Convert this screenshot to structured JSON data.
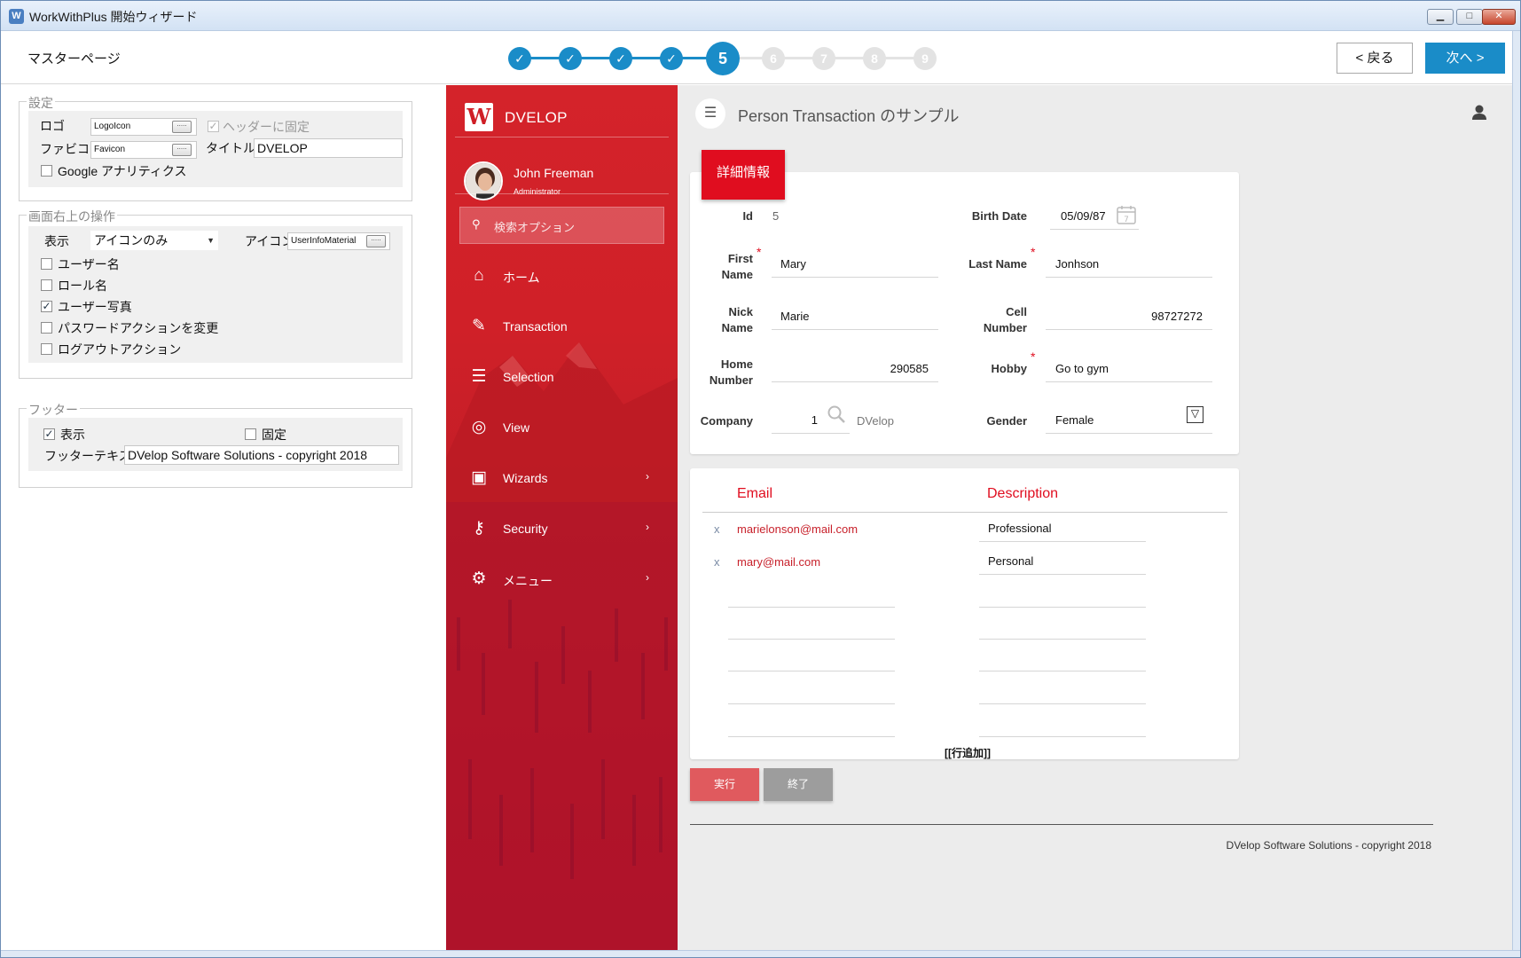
{
  "window": {
    "title": "WorkWithPlus 開始ウィザード",
    "minimize": "▁",
    "maximize": "□",
    "close": "✕"
  },
  "wizard": {
    "page_title": "マスターページ",
    "steps": [
      {
        "label": "✓",
        "state": "done"
      },
      {
        "label": "✓",
        "state": "done"
      },
      {
        "label": "✓",
        "state": "done"
      },
      {
        "label": "✓",
        "state": "done"
      },
      {
        "label": "5",
        "state": "current"
      },
      {
        "label": "6",
        "state": "future"
      },
      {
        "label": "7",
        "state": "future"
      },
      {
        "label": "8",
        "state": "future"
      },
      {
        "label": "9",
        "state": "future"
      }
    ],
    "back_label": "< 戻る",
    "next_label": "次へ >"
  },
  "settings": {
    "legend": "設定",
    "logo_label": "ロゴ",
    "logo_value": "LogoIcon",
    "favicon_label": "ファビコン",
    "favicon_value": "Favicon",
    "fixed_header_label": "ヘッダーに固定",
    "title_label": "タイトル",
    "title_value": "DVELOP",
    "google_analytics_label": "Google アナリティクス",
    "browse": "....."
  },
  "top_right_actions": {
    "legend": "画面右上の操作",
    "display_label": "表示",
    "display_value": "アイコンのみ",
    "icon_label": "アイコン",
    "icon_value": "UserInfoMaterial",
    "username_label": "ユーザー名",
    "rolename_label": "ロール名",
    "userphoto_label": "ユーザー写真",
    "change_password_label": "パスワードアクションを変更",
    "logout_label": "ログアウトアクション"
  },
  "footer_settings": {
    "legend": "フッター",
    "show_label": "表示",
    "fixed_label": "固定",
    "text_label": "フッターテキスト",
    "text_value": "DVelop Software Solutions - copyright 2018"
  },
  "preview": {
    "brand": "DVELOP",
    "brand_logo": "W",
    "user_name": "John Freeman",
    "user_role": "Administrator",
    "search_placeholder": "検索オプション",
    "menu": [
      {
        "label": "ホーム",
        "icon": "home-icon",
        "chevron": ""
      },
      {
        "label": "Transaction",
        "icon": "edit-icon",
        "chevron": ""
      },
      {
        "label": "Selection",
        "icon": "list-icon",
        "chevron": ""
      },
      {
        "label": "View",
        "icon": "target-icon",
        "chevron": ""
      },
      {
        "label": "Wizards",
        "icon": "briefcase-icon",
        "chevron": "›"
      },
      {
        "label": "Security",
        "icon": "key-icon",
        "chevron": "›"
      },
      {
        "label": "メニュー",
        "icon": "gears-icon",
        "chevron": "›"
      }
    ],
    "page_title": "Person Transaction のサンプル",
    "detail_tab": "詳細情報",
    "fields": {
      "id_label": "Id",
      "id_value": "5",
      "birth_label": "Birth Date",
      "birth_value": "05/09/87",
      "first_label": "First\nName",
      "first_value": "Mary",
      "last_label": "Last Name",
      "last_value": "Jonhson",
      "nick_label": "Nick\nName",
      "nick_value": "Marie",
      "cell_label": "Cell\nNumber",
      "cell_value": "98727272",
      "home_label": "Home\nNumber",
      "home_value": "290585",
      "hobby_label": "Hobby",
      "hobby_value": "Go to gym",
      "company_label": "Company",
      "company_value": "1",
      "company_name": "DVelop",
      "gender_label": "Gender",
      "gender_value": "Female"
    },
    "required_mark": "*",
    "calendar_day": "7",
    "grid": {
      "email_header": "Email",
      "description_header": "Description",
      "delete_mark": "x",
      "rows": [
        {
          "email": "marielonson@mail.com",
          "description": "Professional"
        },
        {
          "email": "mary@mail.com",
          "description": "Personal"
        }
      ],
      "add_row_label": "[[行追加]]"
    },
    "execute_label": "実行",
    "close_label": "終了",
    "footer": "DVelop Software Solutions - copyright 2018"
  }
}
